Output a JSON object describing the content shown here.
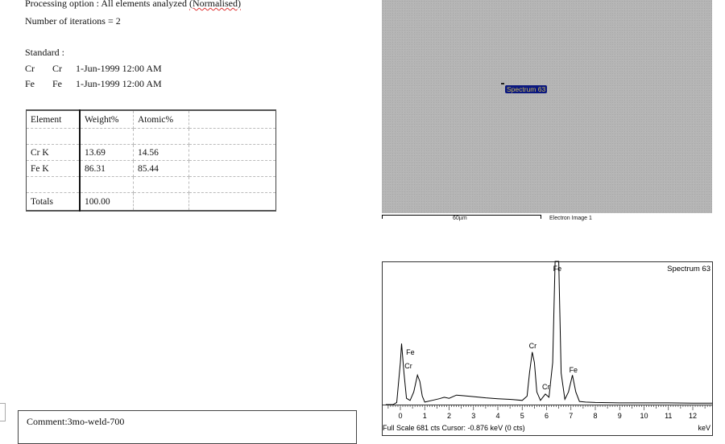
{
  "report": {
    "processing_option": "Processing option : All elements analyzed (Normalised)",
    "processing_prefix": "Processing option : All elements analyzed ",
    "processing_suffix": "(Normalised)",
    "iterations": "Number of iterations = 2",
    "standard_label": "Standard :",
    "standards": [
      {
        "element": "Cr",
        "standard": "Cr",
        "date": "1-Jun-1999 12:00 AM"
      },
      {
        "element": "Fe",
        "standard": "Fe",
        "date": "1-Jun-1999 12:00 AM"
      }
    ],
    "table": {
      "headers": [
        "Element",
        "Weight%",
        "Atomic%",
        ""
      ],
      "rows": [
        [
          "Cr K",
          "13.69",
          "14.56",
          ""
        ],
        [
          "Fe K",
          "86.31",
          "85.44",
          ""
        ]
      ],
      "totals": [
        "Totals",
        "100.00",
        "",
        ""
      ]
    },
    "comment": "Comment:3mo-weld-700"
  },
  "image": {
    "spot_label": "Spectrum 63",
    "spot_color": "#0b1880",
    "scale_label": "60µm",
    "caption": "Electron Image 1"
  },
  "chart_data": {
    "type": "line",
    "title": "Spectrum 63",
    "xlabel": "keV",
    "xlim": [
      -0.6,
      12.8
    ],
    "ylim": [
      0,
      681
    ],
    "xticks": [
      "0",
      "1",
      "2",
      "3",
      "4",
      "5",
      "6",
      "7",
      "8",
      "9",
      "10",
      "11",
      "12"
    ],
    "footer": "Full Scale 681 cts  Cursor: -0.876 keV (0 cts)",
    "grid": false,
    "line_color": "#000000",
    "x": [
      -0.6,
      -0.3,
      -0.15,
      0,
      0.05,
      0.15,
      0.25,
      0.4,
      0.55,
      0.7,
      0.8,
      0.9,
      1.0,
      1.3,
      1.6,
      1.8,
      2.0,
      2.3,
      2.6,
      3.0,
      3.5,
      4.0,
      4.5,
      5.0,
      5.2,
      5.3,
      5.41,
      5.5,
      5.6,
      5.75,
      5.95,
      6.1,
      6.25,
      6.35,
      6.4,
      6.5,
      6.6,
      6.75,
      6.9,
      7.06,
      7.2,
      7.35,
      7.6,
      8,
      9,
      10,
      11,
      12,
      12.8
    ],
    "y": [
      0,
      0,
      10,
      200,
      290,
      150,
      30,
      20,
      60,
      140,
      110,
      40,
      12,
      20,
      28,
      35,
      30,
      45,
      42,
      38,
      32,
      28,
      25,
      20,
      40,
      150,
      250,
      200,
      60,
      20,
      50,
      35,
      200,
      750,
      800,
      700,
      150,
      25,
      60,
      140,
      60,
      15,
      12,
      10,
      8,
      8,
      8,
      7,
      7
    ],
    "annotations": [
      {
        "label": "Fe",
        "kev": 6.4
      },
      {
        "label": "Fe",
        "kev": 0.7
      },
      {
        "label": "Cr",
        "kev": 0.57
      },
      {
        "label": "Cr",
        "kev": 5.41
      },
      {
        "label": "Cr",
        "kev": 5.95
      },
      {
        "label": "Fe",
        "kev": 7.06
      }
    ]
  }
}
